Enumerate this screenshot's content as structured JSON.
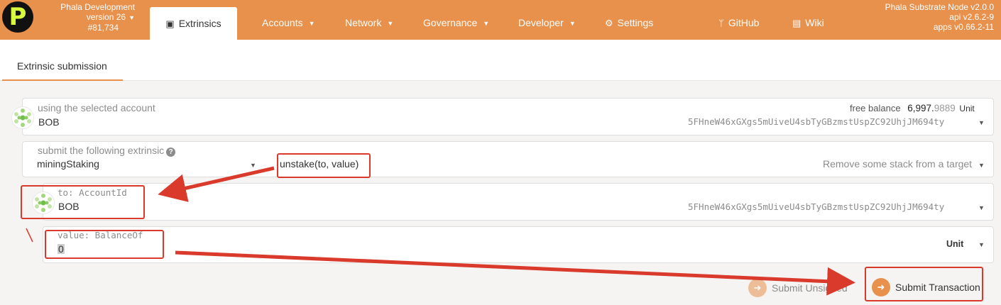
{
  "topbar": {
    "chain_name": "Phala Development",
    "chain_version": "version 26",
    "block": "#81,734",
    "active_tab": "Extrinsics",
    "nav": [
      {
        "label": "Accounts"
      },
      {
        "label": "Network"
      },
      {
        "label": "Governance"
      },
      {
        "label": "Developer"
      },
      {
        "label": "Settings"
      },
      {
        "label": "GitHub"
      },
      {
        "label": "Wiki"
      }
    ],
    "node": "Phala Substrate Node v2.0.0",
    "api": "api v2.6.2-9",
    "apps": "apps v0.66.2-11"
  },
  "subtabs": {
    "active": "Extrinsic submission"
  },
  "account": {
    "label": "using the selected account",
    "name": "BOB",
    "free_balance_label": "free balance",
    "balance_main": "6,997.",
    "balance_decimals": "9889",
    "balance_unit": "Unit",
    "address": "5FHneW46xGXgs5mUiveU4sbTyGBzmstUspZC92UhjJM694ty"
  },
  "extrinsic": {
    "label": "submit the following extrinsic",
    "help": "?",
    "module": "miningStaking",
    "method": "unstake(to, value)",
    "description": "Remove some stack from a target"
  },
  "param_to": {
    "label": "to: AccountId",
    "name": "BOB",
    "address": "5FHneW46xGXgs5mUiveU4sbTyGBzmstUspZC92UhjJM694ty"
  },
  "param_value": {
    "label": "value: BalanceOf",
    "value": "0",
    "unit": "Unit"
  },
  "buttons": {
    "unsigned": "Submit Unsigned",
    "submit": "Submit Transaction"
  },
  "colors": {
    "brand": "#e8914c",
    "annotation": "#d93a2b"
  }
}
